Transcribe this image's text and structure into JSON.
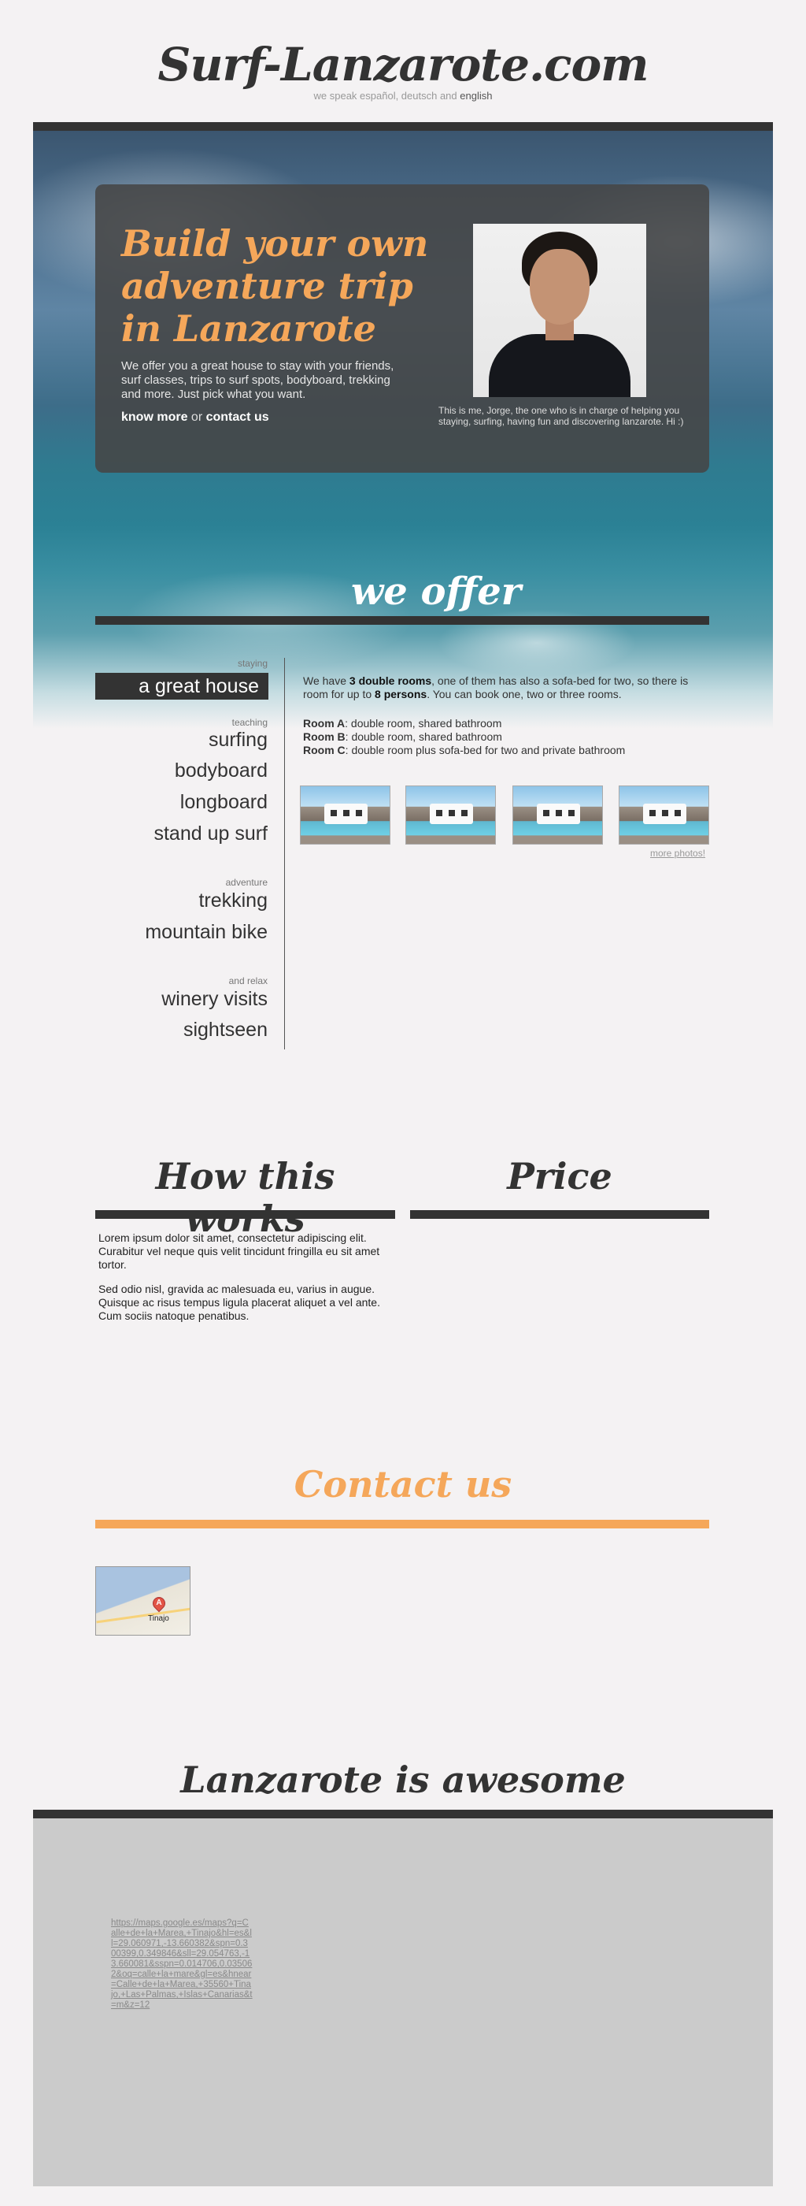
{
  "site": {
    "title": "Surf-Lanzarote.com",
    "lang_prefix": "we speak español, deutsch and ",
    "lang_current": "english"
  },
  "hero": {
    "heading": "Build your own adventure trip in Lanzarote",
    "description": "We offer you a great house to stay with your friends, surf classes, trips to surf spots, bodyboard, trekking and more. Just pick what you want.",
    "link_know_more": "know more",
    "link_or": " or ",
    "link_contact": "contact us",
    "photo_caption": "This is me, Jorge, the one who is in charge of helping you staying, surfing, having fun and discovering lanzarote. Hi :)"
  },
  "offer": {
    "title": "we offer",
    "categories": [
      {
        "label": "staying",
        "items": [
          "a great house"
        ]
      },
      {
        "label": "teaching",
        "items": [
          "surfing",
          "bodyboard",
          "longboard",
          "stand up surf"
        ]
      },
      {
        "label": "adventure",
        "items": [
          "trekking",
          "mountain bike"
        ]
      },
      {
        "label": "and relax",
        "items": [
          "winery visits",
          "sightseen"
        ]
      }
    ],
    "house": {
      "t1": "We have ",
      "b1": "3 double rooms",
      "t2": ", one of them has also a sofa-bed for two, so there is room for up to ",
      "b2": "8 persons",
      "t3": ". You can book one, two or three rooms.",
      "rooms": [
        {
          "name": "Room A",
          "desc": ": double room, shared bathroom"
        },
        {
          "name": "Room B",
          "desc": ": double room, shared bathroom"
        },
        {
          "name": "Room C",
          "desc": ": double room plus sofa-bed for two and private bathroom"
        }
      ],
      "more_photos": "more photos!"
    }
  },
  "how": {
    "title": "How this works",
    "p1": "Lorem ipsum dolor sit amet, consectetur adipiscing elit. Curabitur vel neque quis velit tincidunt fringilla eu sit amet tortor.",
    "p2": "Sed odio nisl, gravida ac malesuada eu, varius in augue. Quisque ac risus tempus ligula placerat aliquet a vel ante. Cum sociis natoque penatibus."
  },
  "price": {
    "title": "Price"
  },
  "contact": {
    "title": "Contact us",
    "map_pin": "A",
    "map_town": "Tinajo"
  },
  "awesome": {
    "title": "Lanzarote is awesome",
    "link": "https://maps.google.es/maps?q=Calle+de+la+Marea,+Tinajo&hl=es&ll=29.060971,-13.660382&spn=0.300399,0.349846&sll=29.054763,-13.660081&sspn=0.014706,0.035062&oq=calle+la+mare&gl=es&hnear=Calle+de+la+Marea,+35560+Tinajo,+Las+Palmas,+Islas+Canarias&t=m&z=12"
  },
  "colors": {
    "accent_orange": "#f5a75a",
    "dark_bar": "#333333",
    "page_bg": "#f4f2f3"
  }
}
